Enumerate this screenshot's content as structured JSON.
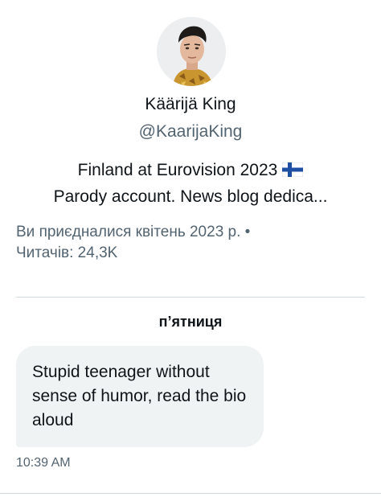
{
  "profile": {
    "avatar_icon": "profile-photo",
    "name": "Käärijä King",
    "handle": "@KaarijaKing",
    "bio_line1": "Finland at Eurovision 2023",
    "bio_flag_icon": "finland-flag",
    "bio_line2": "Parody account. News blog dedica...",
    "joined": "Ви приєдналися квітень 2023 р. •",
    "followers": "Читачів: 24,3K"
  },
  "conversation": {
    "day_label": "п’ятниця",
    "messages": [
      {
        "text": "Stupid teenager without sense of humor, read the bio aloud",
        "time": "10:39 AM"
      }
    ]
  },
  "colors": {
    "text_primary": "#0f1419",
    "text_secondary": "#536471",
    "bubble_bg": "#eff3f4",
    "divider": "#cfd9de"
  }
}
